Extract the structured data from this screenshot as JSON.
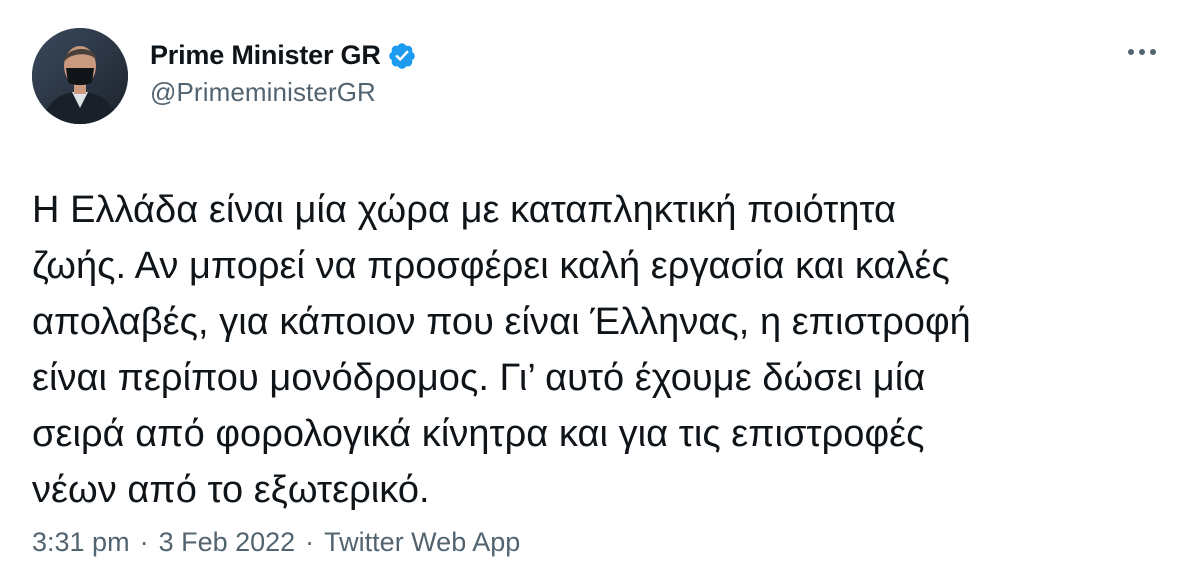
{
  "author": {
    "display_name": "Prime Minister GR",
    "handle": "@PrimeministerGR",
    "verified_icon": "verified-badge-icon",
    "avatar_icon": "profile-photo"
  },
  "menu": {
    "more_icon": "more-horizontal-icon"
  },
  "tweet": {
    "text": "Η Ελλάδα είναι μία χώρα με καταπληκτική ποιότητα\nζωής. Αν μπορεί να προσφέρει καλή εργασία και καλές\nαπολαβές, για κάποιον που είναι Έλληνας, η επιστροφή\nείναι περίπου μονόδρομος. Γι’ αυτό έχουμε δώσει μία\nσειρά από φορολογικά κίνητρα και για τις επιστροφές\nνέων από το εξωτερικό."
  },
  "meta": {
    "time": "3:31 pm",
    "separator": "·",
    "date": "3 Feb 2022",
    "source": "Twitter Web App"
  },
  "colors": {
    "text_primary": "#0f1419",
    "text_secondary": "#536471",
    "verified_blue": "#1d9bf0"
  }
}
